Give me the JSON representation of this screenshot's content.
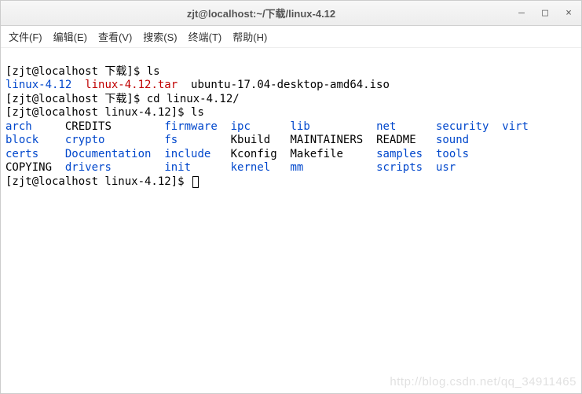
{
  "titlebar": {
    "title": "zjt@localhost:~/下载/linux-4.12",
    "minimize": "–",
    "maximize": "□",
    "close": "×"
  },
  "menubar": {
    "file": "文件(F)",
    "edit": "编辑(E)",
    "view": "查看(V)",
    "search": "搜索(S)",
    "terminal": "终端(T)",
    "help": "帮助(H)"
  },
  "lines": {
    "l1_prompt": "[zjt@localhost 下载]$ ",
    "l1_cmd": "ls",
    "l2_a": "linux-4.12",
    "l2_b": "linux-4.12.tar",
    "l2_c": "  ubuntu-17.04-desktop-amd64.iso",
    "l3_prompt": "[zjt@localhost 下载]$ ",
    "l3_cmd": "cd linux-4.12/",
    "l4_prompt": "[zjt@localhost linux-4.12]$ ",
    "l4_cmd": "ls",
    "r1c1": "arch",
    "r1c2": "CREDITS",
    "r1c3": "firmware",
    "r1c4": "ipc",
    "r1c5": "lib",
    "r1c6": "net",
    "r1c7": "security",
    "r1c8": "virt",
    "r2c1": "block",
    "r2c2": "crypto",
    "r2c3": "fs",
    "r2c4": "Kbuild",
    "r2c5": "MAINTAINERS",
    "r2c6": "README",
    "r2c7": "sound",
    "r3c1": "certs",
    "r3c2": "Documentation",
    "r3c3": "include",
    "r3c4": "Kconfig",
    "r3c5": "Makefile",
    "r3c6": "samples",
    "r3c7": "tools",
    "r4c1": "COPYING",
    "r4c2": "drivers",
    "r4c3": "init",
    "r4c4": "kernel",
    "r4c5": "mm",
    "r4c6": "scripts",
    "r4c7": "usr",
    "l9_prompt": "[zjt@localhost linux-4.12]$ "
  },
  "watermark": "http://blog.csdn.net/qq_34911465"
}
